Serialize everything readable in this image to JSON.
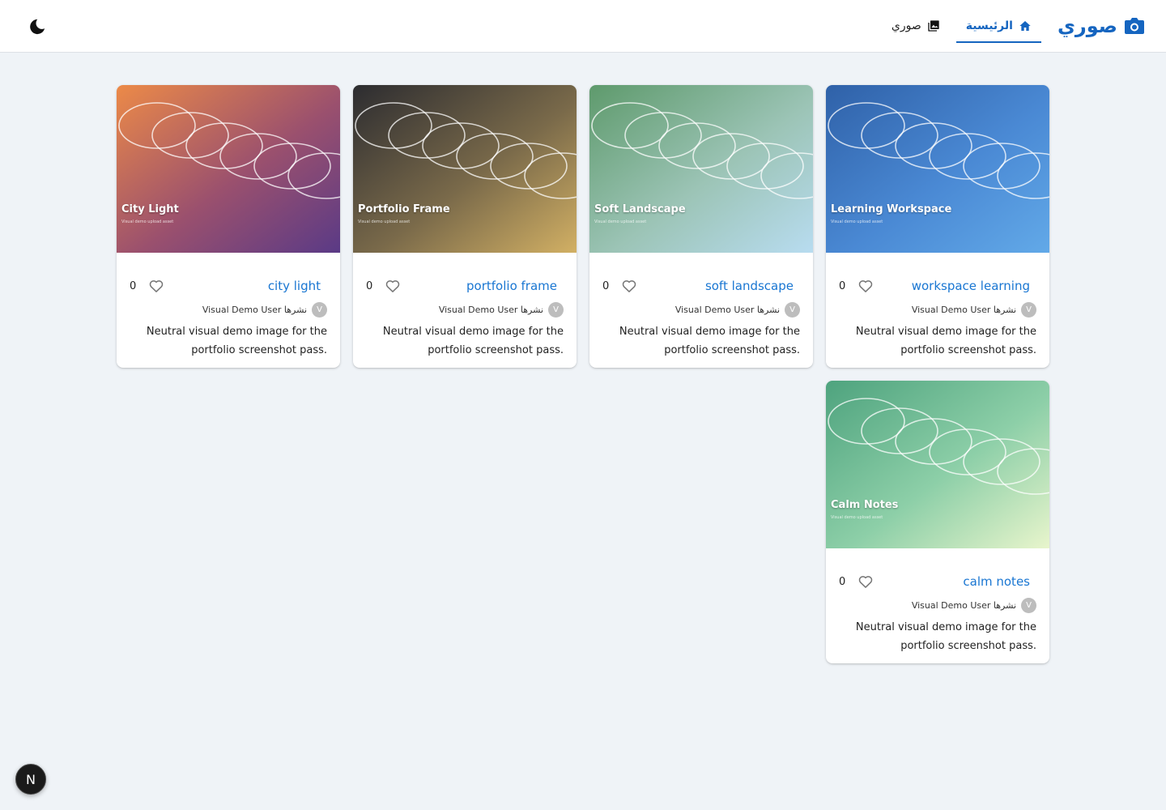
{
  "header": {
    "brand": "صوري",
    "nav": [
      {
        "label": "الرئيسية",
        "active": true
      },
      {
        "label": "صوري",
        "active": false
      }
    ]
  },
  "colors": {
    "accent": "#1565c0",
    "title_link": "#1976d2"
  },
  "cards": [
    {
      "title": "workspace learning",
      "image_title": "Learning Workspace",
      "image_sub": "Visual demo upload asset",
      "likes": "0",
      "author": "نشرها Visual Demo User",
      "avatar": "V",
      "description": "Neutral visual demo image for the portfolio screenshot pass.",
      "gradient": [
        "#2f61a8",
        "#4a89d4",
        "#62a9e8"
      ]
    },
    {
      "title": "soft landscape",
      "image_title": "Soft Landscape",
      "image_sub": "Visual demo upload asset",
      "likes": "0",
      "author": "نشرها Visual Demo User",
      "avatar": "V",
      "description": "Neutral visual demo image for the portfolio screenshot pass.",
      "gradient": [
        "#5e9a6c",
        "#9cc4b6",
        "#b8dcf0"
      ]
    },
    {
      "title": "portfolio frame",
      "image_title": "Portfolio Frame",
      "image_sub": "Visual demo upload asset",
      "likes": "0",
      "author": "نشرها Visual Demo User",
      "avatar": "V",
      "description": "Neutral visual demo image for the portfolio screenshot pass.",
      "gradient": [
        "#2c2c30",
        "#7a6a4a",
        "#d2b064"
      ]
    },
    {
      "title": "city light",
      "image_title": "City Light",
      "image_sub": "Visual demo upload asset",
      "likes": "0",
      "author": "نشرها Visual Demo User",
      "avatar": "V",
      "description": "Neutral visual demo image for the portfolio screenshot pass.",
      "gradient": [
        "#ec8a48",
        "#9a506e",
        "#5a3a86"
      ]
    },
    {
      "title": "calm notes",
      "image_title": "Calm Notes",
      "image_sub": "Visual demo upload asset",
      "likes": "0",
      "author": "نشرها Visual Demo User",
      "avatar": "V",
      "description": "Neutral visual demo image for the portfolio screenshot pass.",
      "gradient": [
        "#4ea37e",
        "#8dcfa8",
        "#e8f5cc"
      ]
    }
  ],
  "badge": "N"
}
